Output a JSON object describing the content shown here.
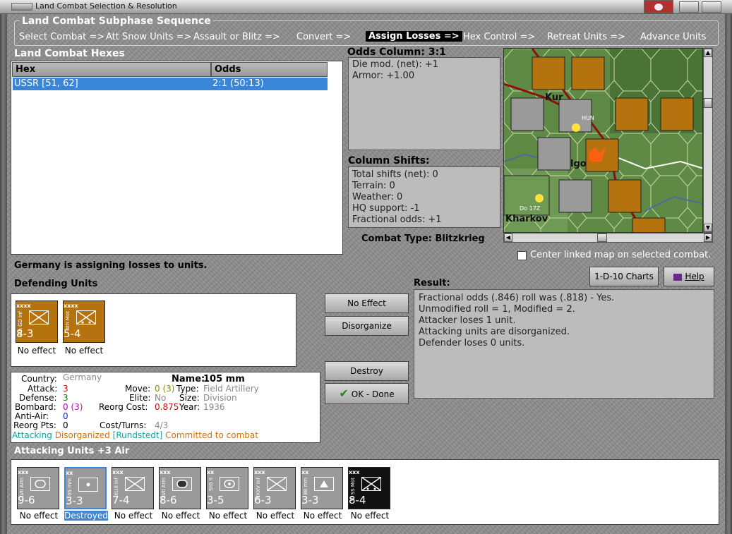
{
  "window": {
    "title": "Land Combat Selection & Resolution"
  },
  "sequence": {
    "title": "Land Combat Subphase Sequence",
    "steps": [
      "Select Combat =>",
      "Att Snow Units =>",
      "Assault or Blitz =>",
      "Convert =>",
      "Assign Losses =>",
      "Hex Control =>",
      "Retreat Units =>",
      "Advance Units"
    ],
    "active_index": 4
  },
  "hexes": {
    "title": "Land Combat Hexes",
    "columns": [
      "Hex",
      "Odds"
    ],
    "rows": [
      {
        "hex": "USSR [51, 62]",
        "odds": "2:1 (50:13)"
      }
    ]
  },
  "odds": {
    "title": "Odds Column: 3:1",
    "lines": [
      "Die mod. (net): +1",
      "Armor: +1.00"
    ]
  },
  "shifts": {
    "title": "Column Shifts:",
    "lines": [
      "Total shifts (net): 0",
      "Terrain: 0",
      "Weather: 0",
      "HQ support: -1",
      "Fractional odds: +1"
    ]
  },
  "combat_type": "Combat Type:  Blitzkrieg",
  "center_map_label": "Center linked map on selected combat.",
  "status": "Germany is assigning losses to units.",
  "defending": {
    "title": "Defending Units",
    "units": [
      {
        "side": "4th GD Inf",
        "size": "xxxx",
        "strength": "8-3",
        "status": "No effect",
        "color": "#b5730f"
      },
      {
        "side": "4th Mot",
        "size": "xxxx",
        "strength": "5-4",
        "status": "No effect",
        "color": "#b5730f"
      }
    ]
  },
  "buttons": {
    "no_effect": "No Effect",
    "disorganize": "Disorganize",
    "destroy": "Destroy",
    "ok_done": "OK - Done",
    "charts": "1-D-10 Charts",
    "help": "Help"
  },
  "result": {
    "title": "Result:",
    "lines": [
      "Fractional odds (.846) roll was (.818)  - Yes.",
      "Unmodified roll = 1, Modified = 2.",
      "Attacker loses 1 unit.",
      "Attacking units are disorganized.",
      "Defender loses 0 units."
    ]
  },
  "details": {
    "country_label": "Country:",
    "country": "Germany",
    "attack_label": "Attack:",
    "attack": "3",
    "defense_label": "Defense:",
    "defense": "3",
    "bombard_label": "Bombard:",
    "bombard": "0 (3)",
    "antiair_label": "Anti-Air:",
    "antiair": "0",
    "reorg_label": "Reorg Pts:",
    "reorg": "0",
    "name_label": "Name:",
    "name": "105 mm",
    "move_label": "Move:",
    "move": "0 (3)",
    "elite_label": "Elite:",
    "elite": "No",
    "reorg_cost_label": "Reorg Cost:",
    "reorg_cost": "0.875",
    "cost_turns_label": "Cost/Turns:",
    "cost_turns": "4/3",
    "type_label": "Type:",
    "type": "Field Artillery",
    "size_label": "Size:",
    "size": "Division",
    "year_label": "Year:",
    "year": "1936",
    "status_attacking": "Attacking",
    "status_disorganized": "Disorganized",
    "status_hq": "[Rundstedt]",
    "status_committed": "Committed to combat"
  },
  "attacking": {
    "title": "Attacking Units +3 Air",
    "units": [
      {
        "side": "LVII Arm",
        "size": "xxx",
        "strength": "9-6",
        "status": "No effect",
        "color": "#9a9a9a",
        "symbol": "armor"
      },
      {
        "side": "105 mm",
        "size": "xx",
        "strength": "3-3",
        "status": "Destroyed",
        "color": "#9a9a9a",
        "symbol": "artillery",
        "selected": true
      },
      {
        "side": "XLIII Inf",
        "size": "xxx",
        "strength": "7-4",
        "status": "No effect",
        "color": "#9a9a9a",
        "symbol": "infantry"
      },
      {
        "side": "XLVII Arm",
        "size": "xxx",
        "strength": "8-6",
        "status": "No effect",
        "color": "#9a9a9a",
        "symbol": "armor-dark"
      },
      {
        "side": "StG II",
        "size": "xx",
        "strength": "3-5",
        "status": "No effect",
        "color": "#9a9a9a",
        "symbol": "assault"
      },
      {
        "side": "XXXV Inf",
        "size": "xxx",
        "strength": "6-3",
        "status": "No effect",
        "color": "#9a9a9a",
        "symbol": "infantry"
      },
      {
        "side": "88 mm",
        "size": "xx",
        "strength": "3-3",
        "status": "No effect",
        "color": "#9a9a9a",
        "symbol": "flak"
      },
      {
        "side": "VI SS Mot",
        "size": "xxx",
        "strength": "8-4",
        "status": "No effect",
        "color": "#111111",
        "symbol": "motorized"
      }
    ]
  },
  "map": {
    "labels": [
      "Kur",
      "Kharkov",
      "lgo",
      "HUN",
      "Do 17Z"
    ]
  }
}
